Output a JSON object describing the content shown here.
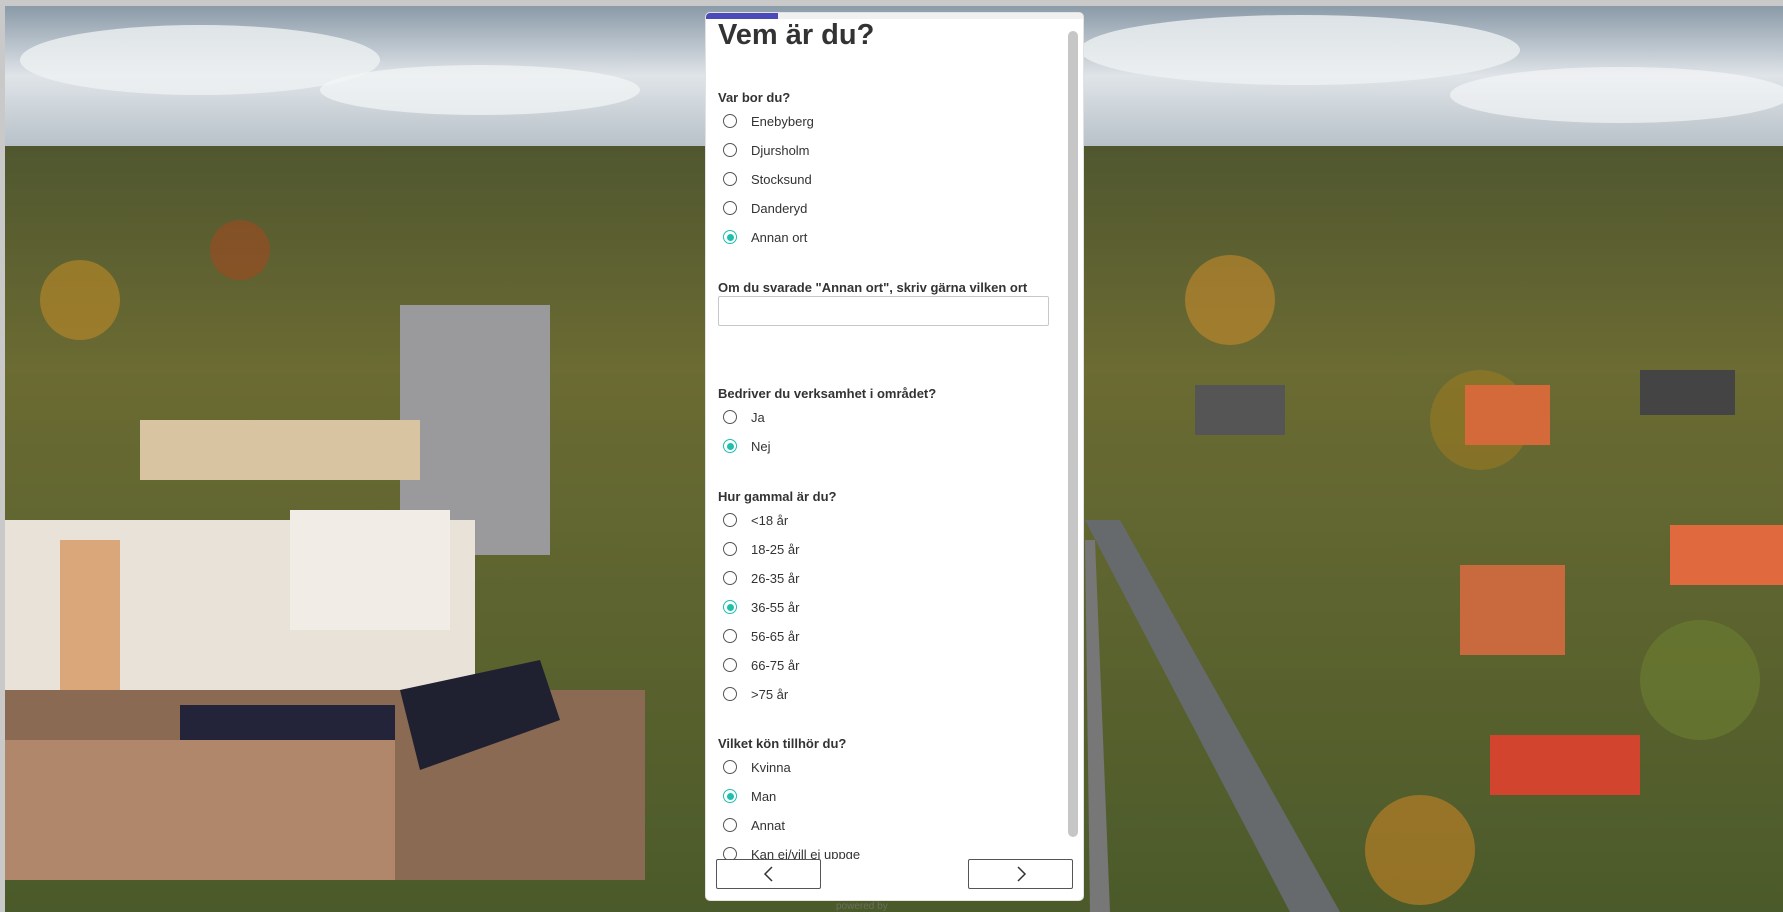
{
  "survey": {
    "title": "Vem är du?",
    "progress_fraction": 0.19,
    "q1": {
      "label": "Var bor du?",
      "options": [
        "Enebyberg",
        "Djursholm",
        "Stocksund",
        "Danderyd",
        "Annan ort"
      ],
      "selected": "Annan ort"
    },
    "q2": {
      "label": "Om du svarade \"Annan ort\", skriv gärna vilken ort",
      "value": ""
    },
    "q3": {
      "label": "Bedriver du verksamhet i området?",
      "options": [
        "Ja",
        "Nej"
      ],
      "selected": "Nej"
    },
    "q4": {
      "label": "Hur gammal är du?",
      "options": [
        "<18 år",
        "18-25 år",
        "26-35 år",
        "36-55 år",
        "56-65 år",
        "66-75 år",
        ">75 år"
      ],
      "selected": "36-55 år"
    },
    "q5": {
      "label": "Vilket kön tillhör du?",
      "options": [
        "Kvinna",
        "Man",
        "Annat",
        "Kan ej/vill ej uppge"
      ],
      "selected": "Man"
    },
    "nav": {
      "back_icon": "chevron-left-icon",
      "next_icon": "chevron-right-icon"
    },
    "footer": "powered by"
  },
  "colors": {
    "accent": "#1fbfae",
    "progress": "#4a4ab8"
  }
}
